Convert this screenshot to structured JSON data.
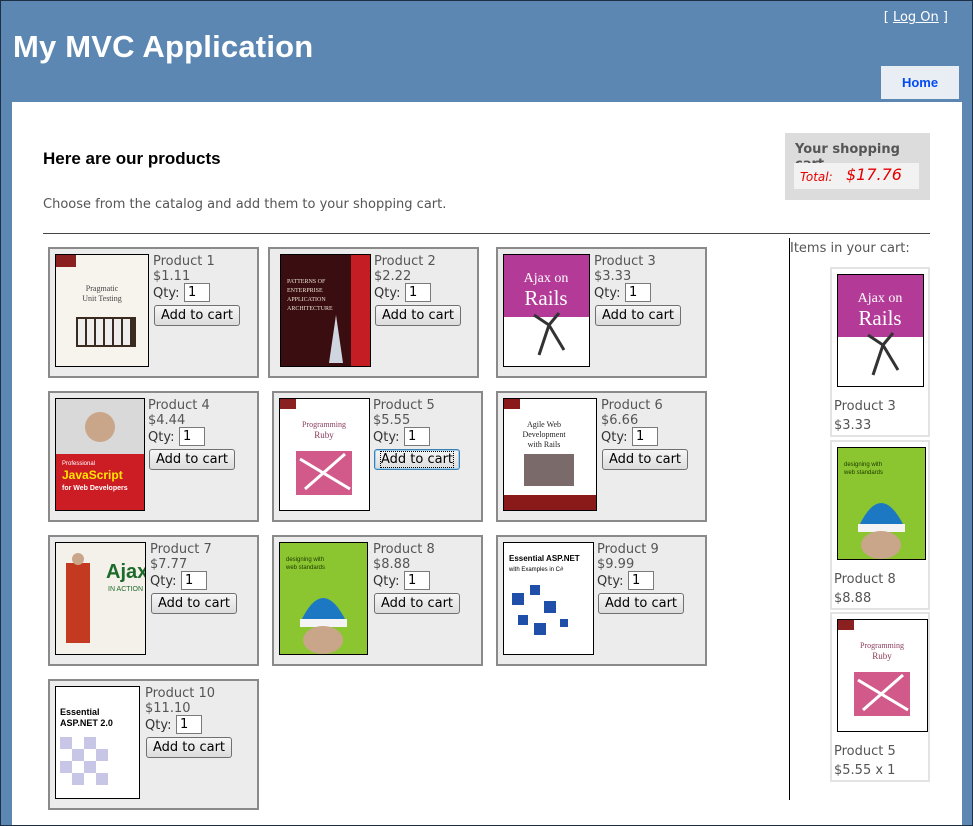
{
  "app": {
    "title": "My MVC Application",
    "login_open": "[",
    "login_label": "Log On",
    "login_close": "]",
    "menu": [
      {
        "label": "Home"
      }
    ]
  },
  "page": {
    "heading": "Here are our products",
    "intro": "Choose from the catalog and add them to your shopping cart."
  },
  "cart": {
    "title": "Your shopping cart",
    "total_label": "Total:",
    "total_value": "$17.76",
    "items_label": "Items in your cart:",
    "items": [
      {
        "name": "Product 3",
        "price": "$3.33"
      },
      {
        "name": "Product 8",
        "price": "$8.88"
      },
      {
        "name": "Product 5",
        "price": "$5.55 x 1"
      }
    ]
  },
  "products": [
    {
      "name": "Product 1",
      "price": "$1.11",
      "qty_label": "Qty:",
      "qty": "1",
      "button": "Add to cart"
    },
    {
      "name": "Product 2",
      "price": "$2.22",
      "qty_label": "Qty:",
      "qty": "1",
      "button": "Add to cart"
    },
    {
      "name": "Product 3",
      "price": "$3.33",
      "qty_label": "Qty:",
      "qty": "1",
      "button": "Add to cart"
    },
    {
      "name": "Product 4",
      "price": "$4.44",
      "qty_label": "Qty:",
      "qty": "1",
      "button": "Add to cart"
    },
    {
      "name": "Product 5",
      "price": "$5.55",
      "qty_label": "Qty:",
      "qty": "1",
      "button": "Add to cart"
    },
    {
      "name": "Product 6",
      "price": "$6.66",
      "qty_label": "Qty:",
      "qty": "1",
      "button": "Add to cart"
    },
    {
      "name": "Product 7",
      "price": "$7.77",
      "qty_label": "Qty:",
      "qty": "1",
      "button": "Add to cart"
    },
    {
      "name": "Product 8",
      "price": "$8.88",
      "qty_label": "Qty:",
      "qty": "1",
      "button": "Add to cart"
    },
    {
      "name": "Product 9",
      "price": "$9.99",
      "qty_label": "Qty:",
      "qty": "1",
      "button": "Add to cart"
    },
    {
      "name": "Product 10",
      "price": "$11.10",
      "qty_label": "Qty:",
      "qty": "1",
      "button": "Add to cart"
    }
  ],
  "covers": [
    {
      "title": "Pragmatic Unit Testing",
      "bg": "#f7f4ee",
      "fg": "#444444",
      "accent": "#8a2020"
    },
    {
      "title": "Patterns of Enterprise Application Architecture",
      "bg": "#3a0d10",
      "fg": "#e8e0d0",
      "accent": "#c41e24"
    },
    {
      "title": "Ajax on Rails",
      "bg": "#b33a97",
      "fg": "#ffffff",
      "accent": "#333333"
    },
    {
      "title": "Professional JavaScript for Web Developers",
      "bg": "#cc1d25",
      "fg": "#ffe600",
      "accent": "#222222"
    },
    {
      "title": "Programming Ruby",
      "bg": "#ffffff",
      "fg": "#8a3b5c",
      "accent": "#d15a8a"
    },
    {
      "title": "Agile Web Development with Rails",
      "bg": "#ffffff",
      "fg": "#222222",
      "accent": "#8a1a1a"
    },
    {
      "title": "Ajax in Action",
      "bg": "#f4f1ea",
      "fg": "#1d6b2a",
      "accent": "#c33a20"
    },
    {
      "title": "designing with web standards",
      "bg": "#8bc52f",
      "fg": "#1b3a00",
      "accent": "#1d78c4"
    },
    {
      "title": "Essential ASP.NET with Examples in C#",
      "bg": "#ffffff",
      "fg": "#000000",
      "accent": "#1f4fa8"
    },
    {
      "title": "Essential ASP.NET 2.0",
      "bg": "#ffffff",
      "fg": "#000000",
      "accent": "#6c6ab0"
    }
  ]
}
